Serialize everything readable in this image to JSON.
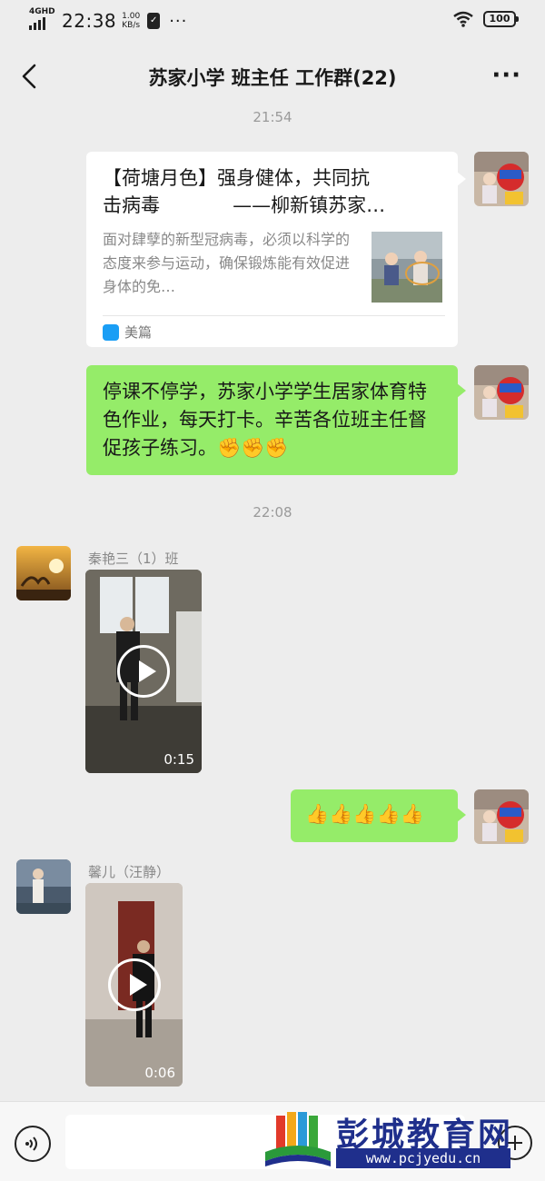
{
  "status_bar": {
    "network": "4GHD",
    "time": "22:38",
    "speed_value": "1.00",
    "speed_unit": "KB/s",
    "dots": "···",
    "battery": "100"
  },
  "header": {
    "title": "苏家小学 班主任 工作群(22)",
    "more": "···"
  },
  "messages": {
    "t1": "21:54",
    "link_card": {
      "title": "【荷塘月色】强身健体，共同抗\n击病毒            ——柳新镇苏家…",
      "description": "面对肆孽的新型冠病毒，必须以科学的态度来参与运动，确保锻炼能有效促进身体的免…",
      "source": "美篇"
    },
    "text1": "停课不停学，苏家小学学生居家体育特色作业，每天打卡。辛苦各位班主任督促孩子练习。✊✊✊",
    "t2": "22:08",
    "video1": {
      "sender": "秦艳三（1）班",
      "duration": "0:15"
    },
    "text2": "👍👍👍👍👍",
    "video2": {
      "sender": "馨儿（汪静）",
      "duration": "0:06"
    }
  },
  "watermark": {
    "name": "彭城教育网",
    "url": "www.pcjyedu.cn"
  },
  "colors": {
    "background": "#ededed",
    "bubble_green": "#95ec69",
    "watermark_blue": "#1f2f8c"
  }
}
